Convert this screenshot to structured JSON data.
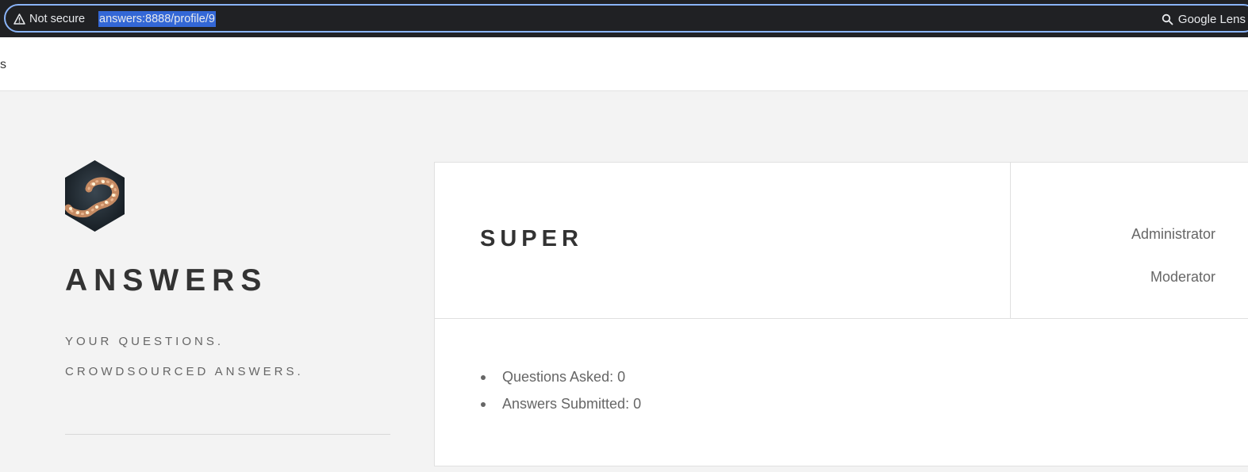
{
  "browser": {
    "security_label": "Not secure",
    "url": "answers:8888/profile/9",
    "lens_label": "Google Lens"
  },
  "nav": {
    "fragment": "s"
  },
  "sidebar": {
    "site_title": "ANSWERS",
    "tagline_line1": "YOUR QUESTIONS.",
    "tagline_line2": "CROWDSOURCED ANSWERS."
  },
  "profile": {
    "username": "SUPER",
    "roles": [
      "Administrator",
      "Moderator"
    ],
    "stats": [
      "Questions Asked: 0",
      "Answers Submitted: 0"
    ]
  }
}
